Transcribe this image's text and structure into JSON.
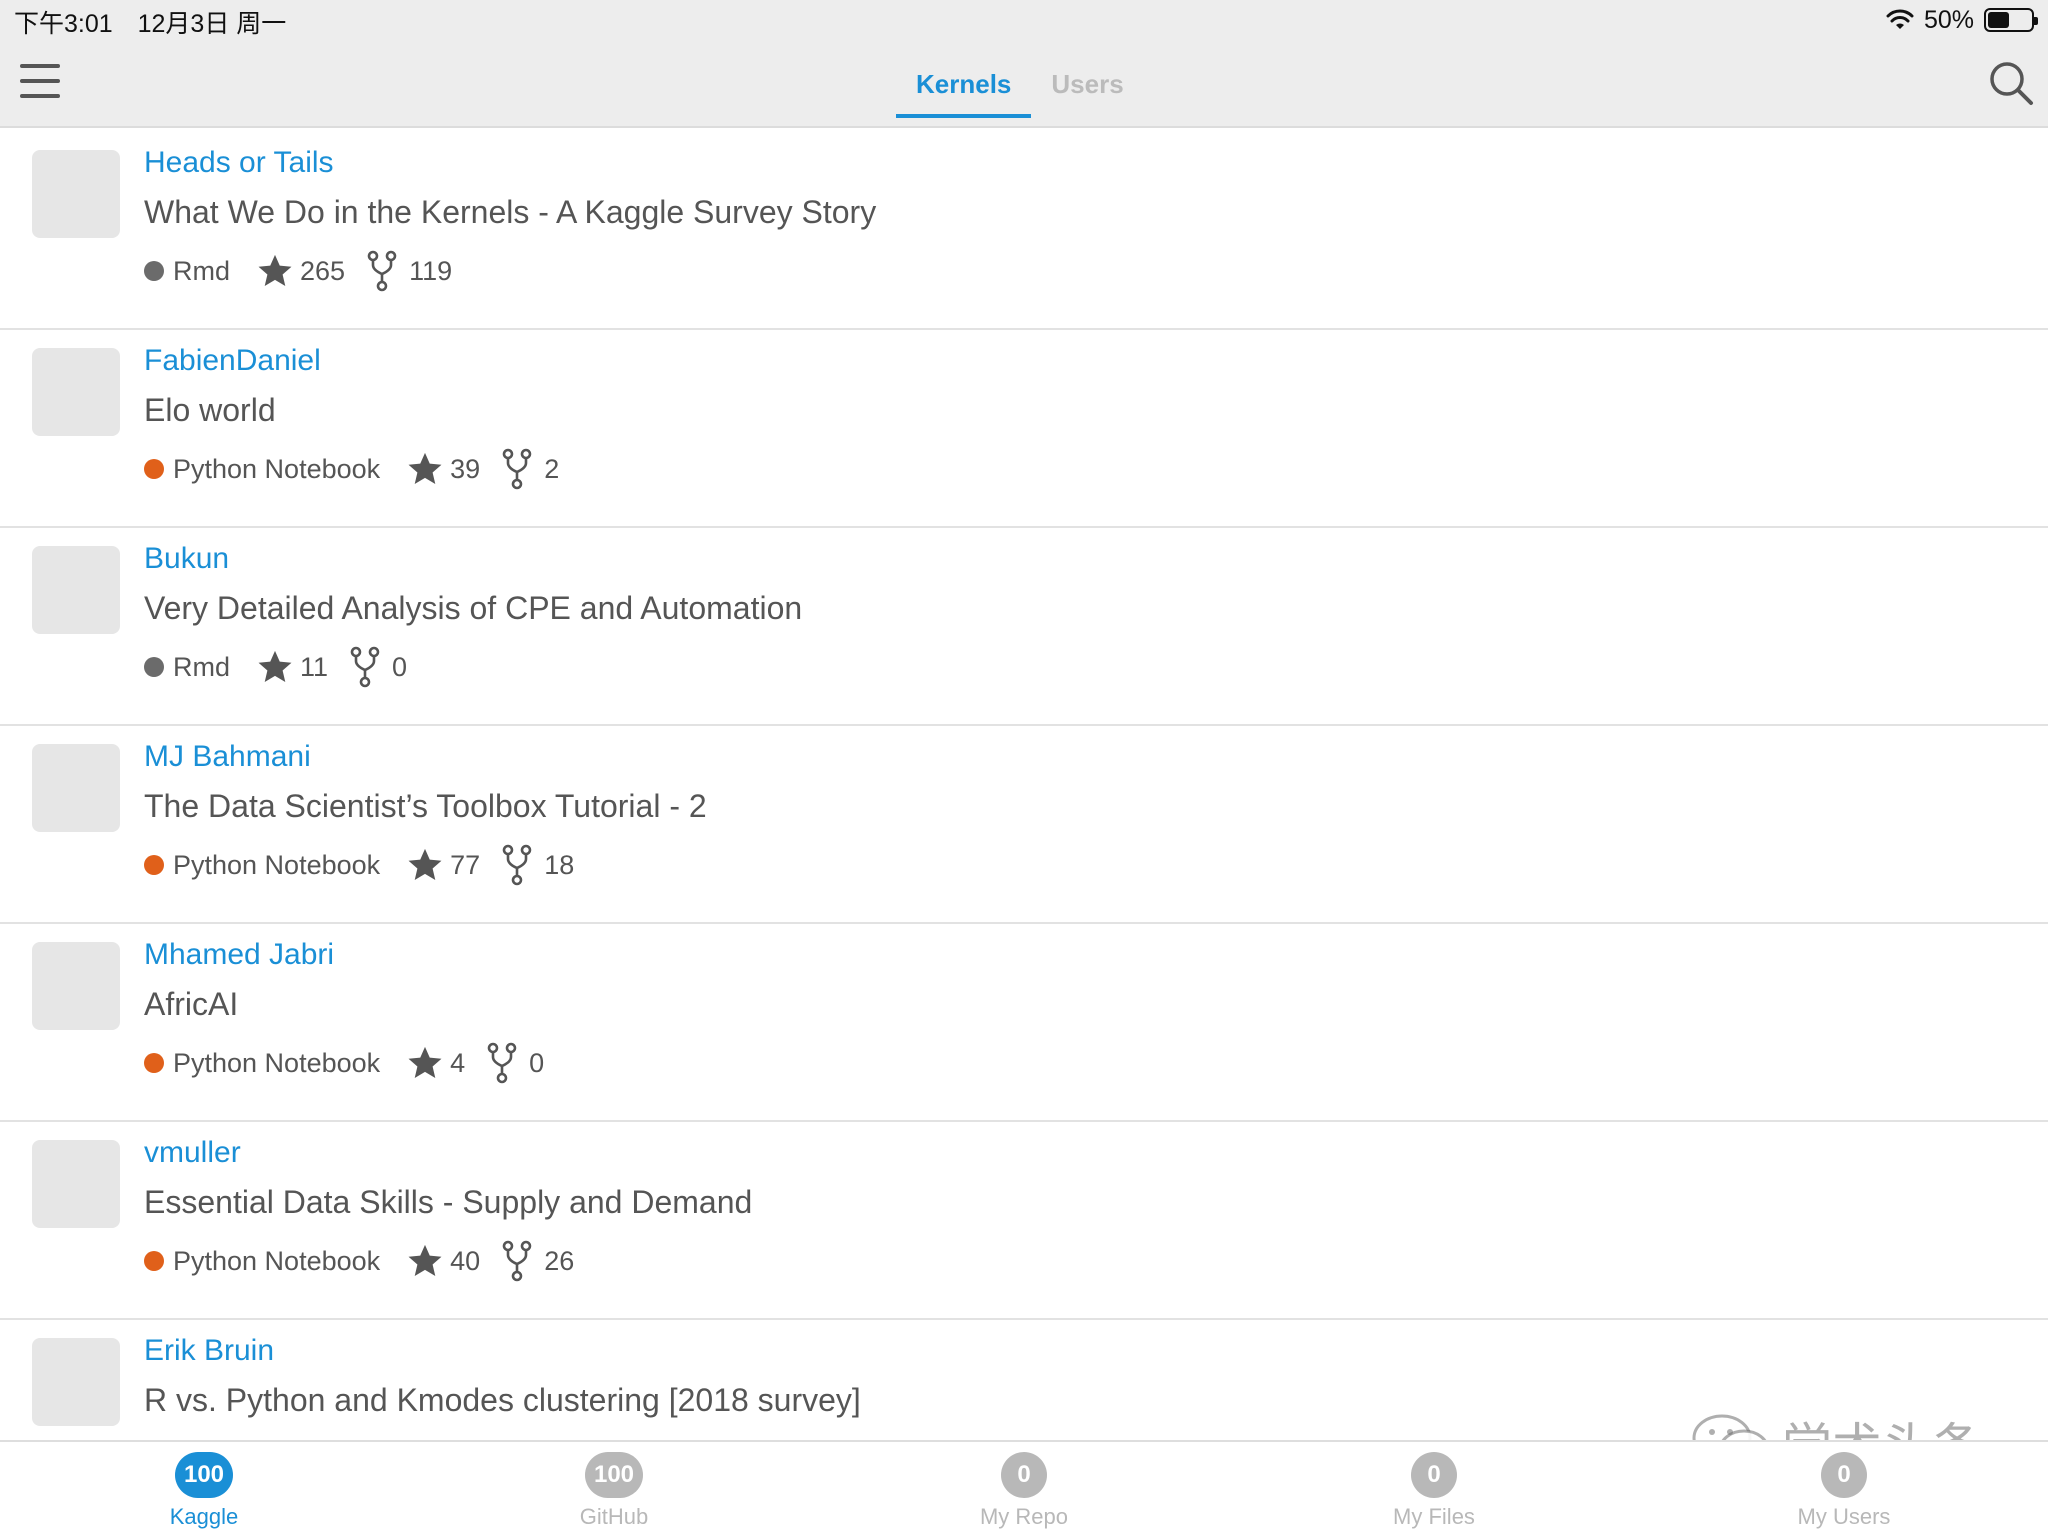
{
  "status_bar": {
    "time": "下午3:01",
    "date": "12月3日 周一",
    "battery_percent": "50%",
    "battery_level": 0.5
  },
  "nav": {
    "tabs": [
      {
        "label": "Kernels",
        "active": true
      },
      {
        "label": "Users",
        "active": false
      }
    ]
  },
  "kernels": [
    {
      "author": "Heads or Tails",
      "title": "What We Do in the Kernels - A Kaggle Survey Story",
      "language": "Rmd",
      "language_color": "#6b6b6b",
      "stars": "265",
      "forks": "119"
    },
    {
      "author": "FabienDaniel",
      "title": "Elo world",
      "language": "Python Notebook",
      "language_color": "#e0601a",
      "stars": "39",
      "forks": "2"
    },
    {
      "author": "Bukun",
      "title": "Very Detailed Analysis of CPE and Automation",
      "language": "Rmd",
      "language_color": "#6b6b6b",
      "stars": "11",
      "forks": "0"
    },
    {
      "author": "MJ Bahmani",
      "title": "The Data Scientist’s Toolbox Tutorial - 2",
      "language": "Python Notebook",
      "language_color": "#e0601a",
      "stars": "77",
      "forks": "18"
    },
    {
      "author": "Mhamed Jabri",
      "title": "AfricAI",
      "language": "Python Notebook",
      "language_color": "#e0601a",
      "stars": "4",
      "forks": "0"
    },
    {
      "author": "vmuller",
      "title": "Essential Data Skills - Supply and Demand",
      "language": "Python Notebook",
      "language_color": "#e0601a",
      "stars": "40",
      "forks": "26"
    },
    {
      "author": "Erik Bruin",
      "title": "R vs. Python and Kmodes clustering [2018 survey]",
      "language": "",
      "language_color": "",
      "stars": "",
      "forks": ""
    }
  ],
  "tab_bar": [
    {
      "badge": "100",
      "label": "Kaggle",
      "active": true
    },
    {
      "badge": "100",
      "label": "GitHub",
      "active": false
    },
    {
      "badge": "0",
      "label": "My Repo",
      "active": false
    },
    {
      "badge": "0",
      "label": "My Files",
      "active": false
    },
    {
      "badge": "0",
      "label": "My Users",
      "active": false
    }
  ],
  "watermark": {
    "text": "学术头条"
  },
  "colors": {
    "accent": "#1a8fd6",
    "rmd": "#6b6b6b",
    "python": "#e0601a",
    "inactive": "#b8b8b8"
  },
  "icons": [
    "menu-icon",
    "search-icon",
    "star-icon",
    "fork-icon",
    "wifi-icon",
    "battery-icon",
    "wechat-icon"
  ]
}
